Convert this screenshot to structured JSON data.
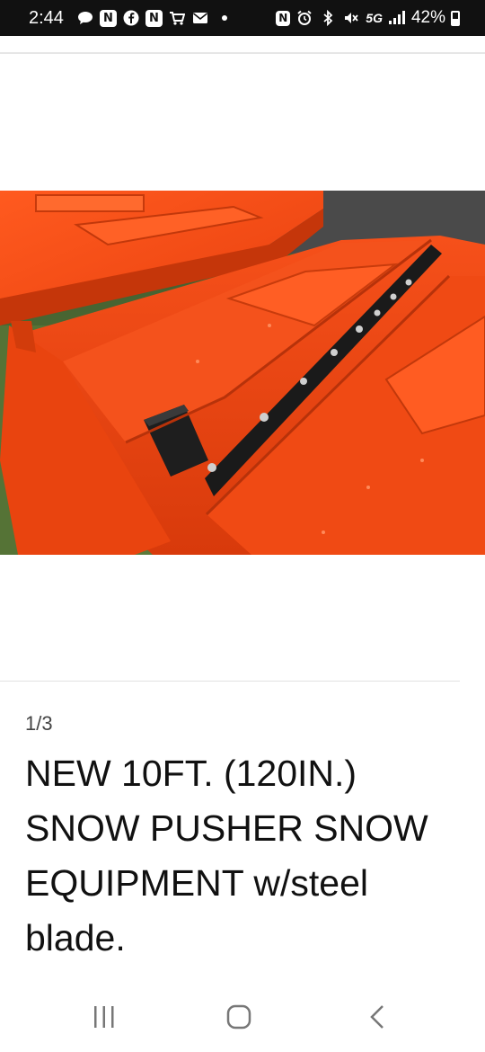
{
  "status_bar": {
    "time": "2:44",
    "left_icons": [
      "chat-bubble-icon",
      "n-app-icon",
      "facebook-icon",
      "n-app-icon",
      "cart-icon",
      "mail-icon",
      "dot-icon"
    ],
    "right_icons": [
      "nfc-icon",
      "alarm-icon",
      "bluetooth-icon",
      "mute-icon",
      "5g-icon",
      "signal-icon",
      "battery-icon"
    ],
    "network": "5G",
    "battery": "42%"
  },
  "listing": {
    "image_counter": "1/3",
    "title": "NEW 10FT. (120IN.) SNOW PUSHER SNOW EQUIPMENT w/steel blade."
  },
  "nav_bar": {
    "buttons": [
      "recents",
      "home",
      "back"
    ]
  },
  "colors": {
    "status_bar_bg": "#111111",
    "product_orange": "#f04a14",
    "text_primary": "#111111"
  }
}
